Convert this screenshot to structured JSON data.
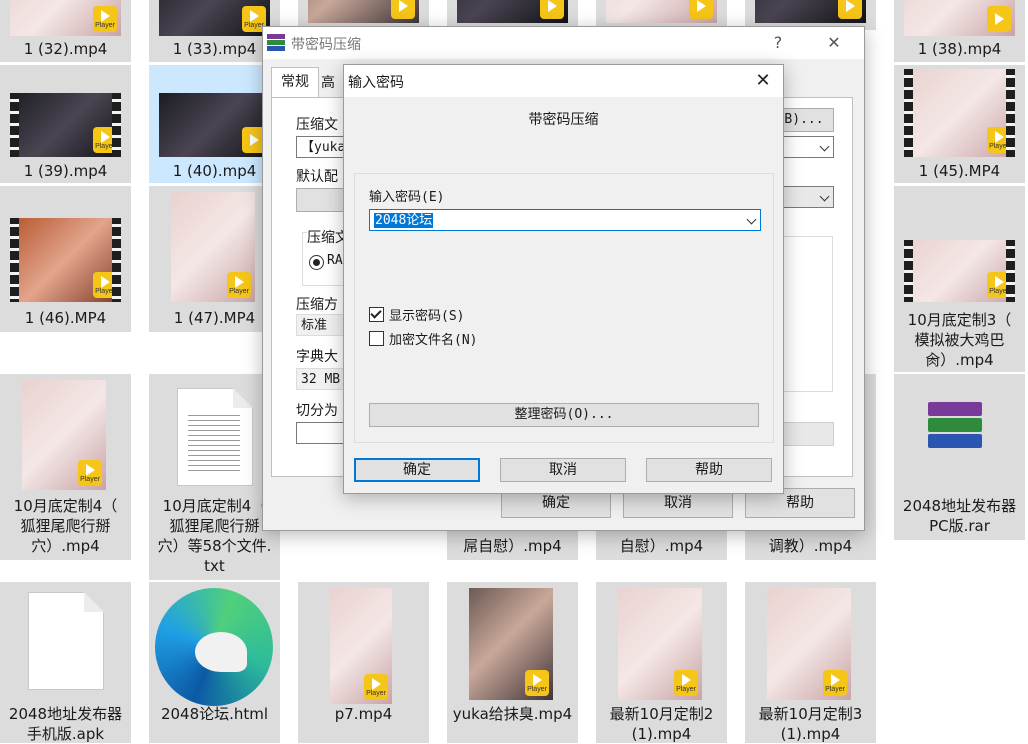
{
  "explorer": {
    "tiles": [
      {
        "label": "1 (32).mp4"
      },
      {
        "label": "1 (33).mp4"
      },
      {
        "label": "1 (38).mp4"
      },
      {
        "label": "1 (39).mp4"
      },
      {
        "label": "1 (40).mp4"
      },
      {
        "label": "1 (45).MP4"
      },
      {
        "label": "1 (46).MP4"
      },
      {
        "label": "1 (47).MP4"
      },
      {
        "label_lines": [
          "10月底定制3（",
          "模拟被大鸡巴",
          "肏）.mp4"
        ]
      },
      {
        "label_lines": [
          "10月底定制4（",
          "狐狸尾爬行掰",
          "穴）.mp4"
        ]
      },
      {
        "label_lines": [
          "10月底定制4（",
          "狐狸尾爬行掰",
          "穴）等58个文件.",
          "txt"
        ]
      },
      {
        "label_lines": [
          "屌自慰）.mp4"
        ]
      },
      {
        "label_lines": [
          "自慰）.mp4"
        ]
      },
      {
        "label_lines": [
          "调教）.mp4"
        ]
      },
      {
        "label_lines": [
          "2048地址发布器",
          "PC版.rar"
        ]
      },
      {
        "label_lines": [
          "2048地址发布器",
          "手机版.apk"
        ]
      },
      {
        "label": "2048论坛.html"
      },
      {
        "label": "p7.mp4"
      },
      {
        "label": "yuka给抹臭.mp4"
      },
      {
        "label_lines": [
          "最新10月定制2",
          "(1).mp4"
        ]
      },
      {
        "label_lines": [
          "最新10月定制3",
          "(1).mp4"
        ]
      }
    ],
    "badge_text": "Player"
  },
  "back_dialog": {
    "title": "带密码压缩",
    "help_symbol": "?",
    "close_symbol": "✕",
    "tabs": [
      {
        "label": "常规"
      },
      {
        "label": "高"
      }
    ],
    "archive_name_label": "压缩文",
    "archive_name_value": "【yuka",
    "browse_label": "B)...",
    "profile_label": "默认配",
    "format_label": "压缩文",
    "format_option": "RA",
    "method_label": "压缩方",
    "method_value": "标准",
    "dict_label": "字典大",
    "dict_value": "32 MB",
    "split_label": "切分为",
    "ok_label": "确定",
    "cancel_label": "取消",
    "help_label": "帮助"
  },
  "password_dialog": {
    "title": "输入密码",
    "close_symbol": "✕",
    "heading": "带密码压缩",
    "password_label": "输入密码(E)",
    "password_value": "2048论坛",
    "show_password_label": "显示密码(S)",
    "show_password_checked": true,
    "encrypt_names_label": "加密文件名(N)",
    "encrypt_names_checked": false,
    "organize_label": "整理密码(O)...",
    "ok_label": "确定",
    "cancel_label": "取消",
    "help_label": "帮助"
  },
  "colors": {
    "selection": "#cce8ff",
    "accent": "#0078d7",
    "badge": "#f5c518"
  }
}
